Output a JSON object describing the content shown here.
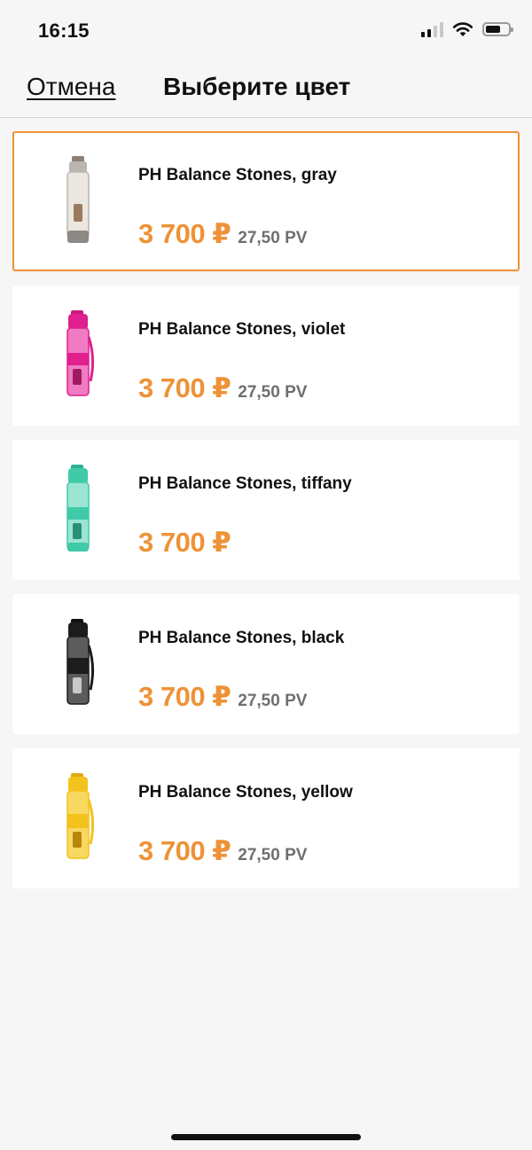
{
  "status_bar": {
    "time": "16:15"
  },
  "nav": {
    "cancel_label": "Отмена",
    "title": "Выберите цвет"
  },
  "products": [
    {
      "name": "PH Balance Stones, gray",
      "price": "3 700 ₽",
      "pv": "27,50 PV",
      "color": "#a8a59f",
      "selected": true
    },
    {
      "name": "PH Balance Stones, violet",
      "price": "3 700 ₽",
      "pv": "27,50 PV",
      "color": "#e0208e",
      "selected": false
    },
    {
      "name": "PH Balance Stones, tiffany",
      "price": "3 700 ₽",
      "pv": "",
      "color": "#3fcaa8",
      "selected": false
    },
    {
      "name": "PH Balance Stones, black",
      "price": "3 700 ₽",
      "pv": "27,50 PV",
      "color": "#1c1c1c",
      "selected": false
    },
    {
      "name": "PH Balance Stones, yellow",
      "price": "3 700 ₽",
      "pv": "27,50 PV",
      "color": "#f3c21c",
      "selected": false
    }
  ],
  "colors": {
    "accent": "#ee9237",
    "selected_border": "#ee9237"
  },
  "icons": {
    "cellular": "cellular-signal-icon",
    "wifi": "wifi-icon",
    "battery": "battery-icon"
  }
}
